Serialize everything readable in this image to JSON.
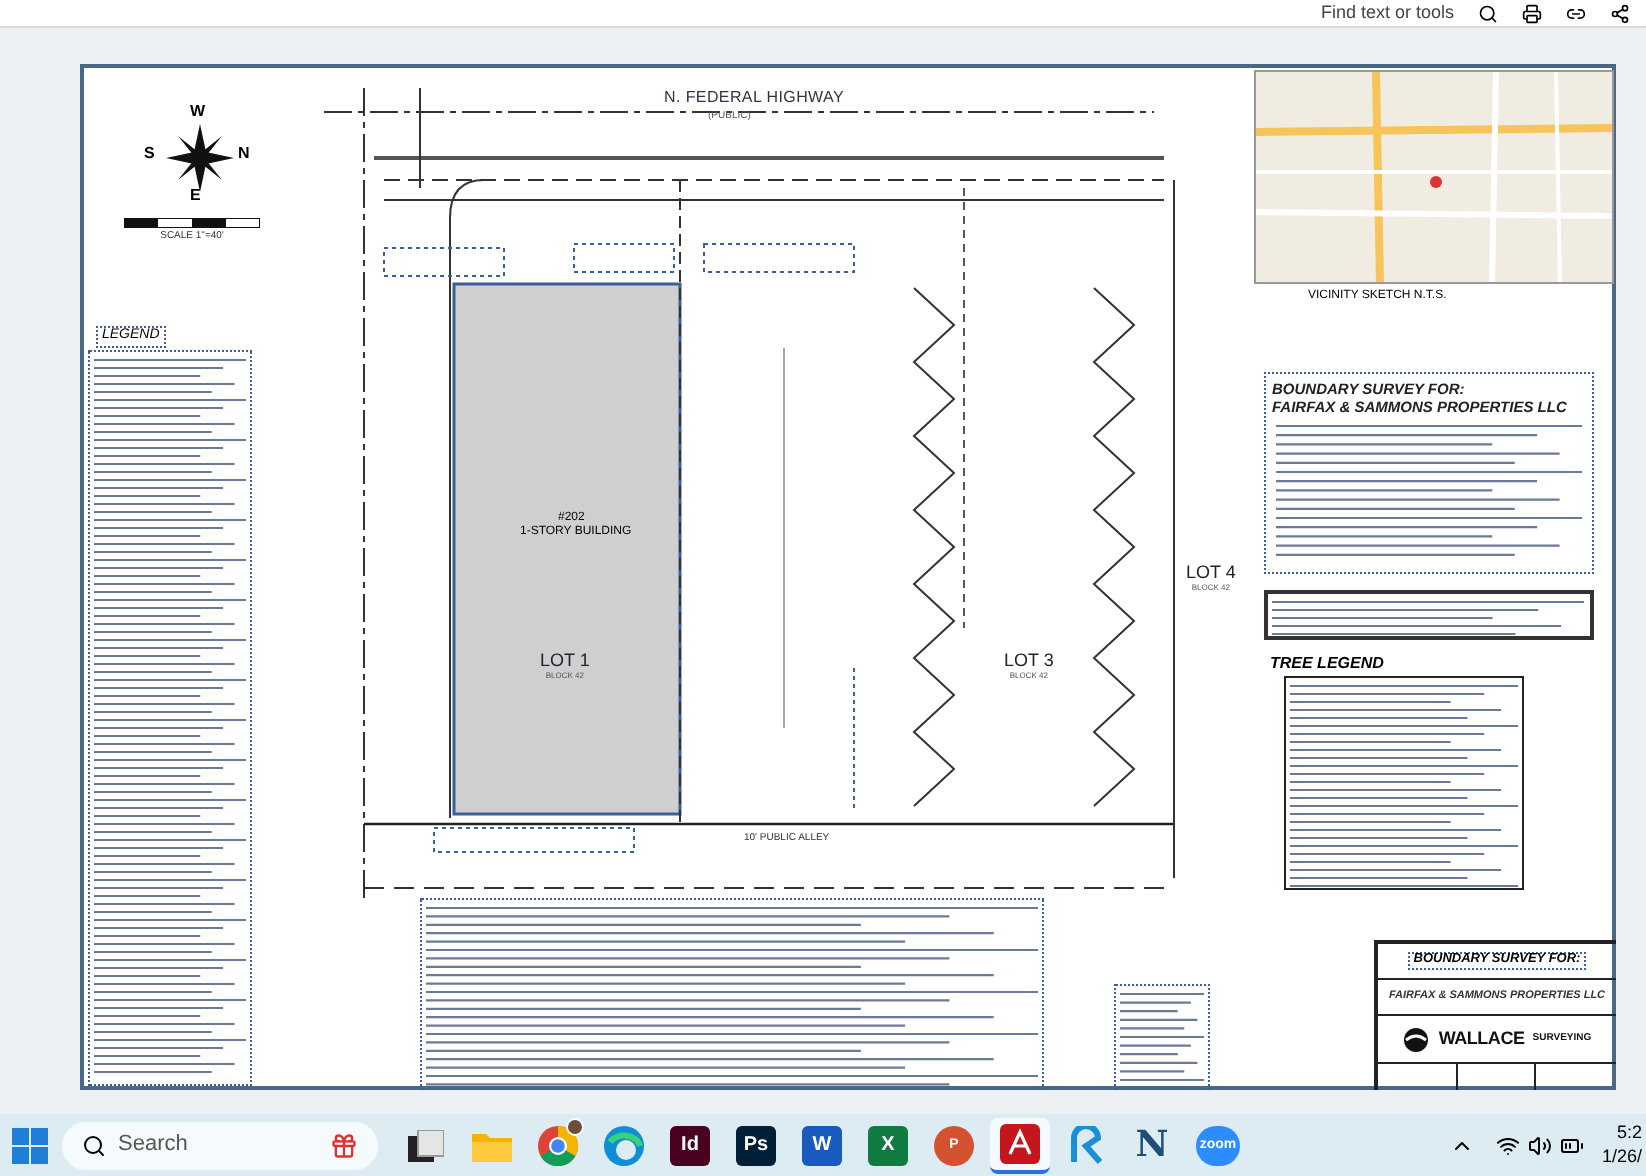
{
  "toolbar": {
    "search_label": "Find text or tools"
  },
  "drawing": {
    "compass_letters": [
      "W",
      "S",
      "N",
      "E"
    ],
    "scale_label": "SCALE 1\"=40'",
    "road": {
      "name": "N. FEDERAL HIGHWAY",
      "note": "(PUBLIC)"
    },
    "legend_title": "LEGEND",
    "building": {
      "number": "#202",
      "label": "1-STORY BUILDING"
    },
    "lots": [
      {
        "name": "LOT 1",
        "block": "BLOCK 42"
      },
      {
        "name": "LOT 3",
        "block": "BLOCK 42"
      },
      {
        "name": "LOT 4",
        "block": "BLOCK 42"
      }
    ],
    "alley": "10' PUBLIC ALLEY",
    "vicinity_caption": "VICINITY SKETCH N.T.S.",
    "survey_heading": [
      "BOUNDARY SURVEY FOR:",
      "FAIRFAX & SAMMONS PROPERTIES LLC"
    ],
    "tree_legend_title": "TREE LEGEND",
    "title_block": {
      "heading": "BOUNDARY SURVEY FOR:",
      "client": "FAIRFAX & SAMMONS PROPERTIES LLC",
      "firm": "WALLACE",
      "firm_sub": "SURVEYING"
    }
  },
  "taskbar": {
    "search_placeholder": "Search",
    "apps": [
      {
        "kind": "taskview",
        "selected": false
      },
      {
        "kind": "folder",
        "selected": false
      },
      {
        "kind": "chrome",
        "selected": false
      },
      {
        "kind": "edge",
        "selected": false
      },
      {
        "kind": "tile",
        "label": "Id",
        "color": "#49021f",
        "selected": false
      },
      {
        "kind": "tile",
        "label": "Ps",
        "color": "#001e36",
        "selected": false
      },
      {
        "kind": "tile",
        "label": "W",
        "color": "#185abd",
        "selected": false
      },
      {
        "kind": "tile",
        "label": "X",
        "color": "#107c41",
        "selected": false
      },
      {
        "kind": "round",
        "label": "P",
        "color": "#d35230",
        "selected": false
      },
      {
        "kind": "acrobat",
        "selected": true
      },
      {
        "kind": "r-app",
        "selected": false
      },
      {
        "kind": "text",
        "label": "N",
        "color": "#1f4e79",
        "selected": false
      },
      {
        "kind": "round",
        "label": "zoom",
        "color": "#2d8cff",
        "selected": false
      }
    ],
    "time": "5:2",
    "date": "1/26/"
  }
}
